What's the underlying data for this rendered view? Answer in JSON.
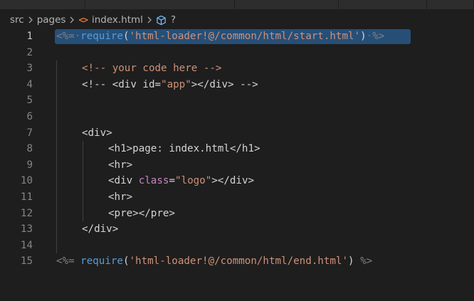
{
  "tabs": [
    "",
    "",
    "",
    "",
    ""
  ],
  "breadcrumb": {
    "src": "src",
    "pages": "pages",
    "file_icon": "<>",
    "file": "index.html",
    "symbol": "?"
  },
  "editor": {
    "selected_line": 1,
    "lines": [
      {
        "n": "1"
      },
      {
        "n": "2"
      },
      {
        "n": "3"
      },
      {
        "n": "4"
      },
      {
        "n": "5"
      },
      {
        "n": "6"
      },
      {
        "n": "7"
      },
      {
        "n": "8"
      },
      {
        "n": "9"
      },
      {
        "n": "10"
      },
      {
        "n": "11"
      },
      {
        "n": "12"
      },
      {
        "n": "13"
      },
      {
        "n": "14"
      },
      {
        "n": "15"
      }
    ],
    "code": {
      "l1_open": "<%=",
      "l1_dot1": "·",
      "l1_fn": "require",
      "l1_paren_open": "(",
      "l1_str": "'html-loader!@/common/html/start.html'",
      "l1_paren_close": ")",
      "l1_dot2": "·",
      "l1_close": "%>",
      "l3": "<!-- your code here -->",
      "l4_a": "<!-- <div id=",
      "l4_b": "\"app\"",
      "l4_c": "></div> -->",
      "l7": "<div>",
      "l8": "<h1>page: index.html</h1>",
      "l9": "<hr>",
      "l10_a": "<div ",
      "l10_attr": "class",
      "l10_eq": "=",
      "l10_val": "\"logo\"",
      "l10_b": "></div>",
      "l11": "<hr>",
      "l12": "<pre></pre>",
      "l13": "</div>",
      "l15_open": "<%=",
      "l15_fn": "require",
      "l15_paren_open": "(",
      "l15_str": "'html-loader!@/common/html/end.html'",
      "l15_paren_close": ")",
      "l15_close": "%>"
    }
  },
  "colors": {
    "background": "#1e1e1e",
    "selection": "#264f78",
    "keyword": "#569cd6",
    "string": "#ce9178",
    "attribute": "#c586c0",
    "text": "#d4d4d4",
    "line_number": "#858585"
  }
}
